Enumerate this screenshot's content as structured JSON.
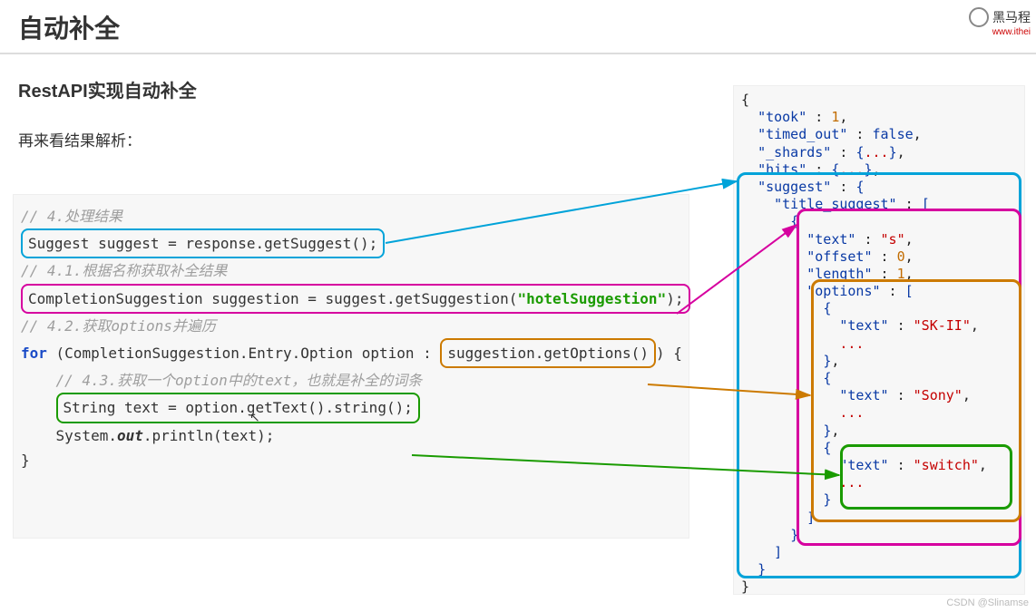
{
  "header": {
    "title": "自动补全",
    "brand_text": "黑马程",
    "brand_url": "www.ithei"
  },
  "section": {
    "subtitle": "RestAPI实现自动补全",
    "description": "再来看结果解析："
  },
  "code": {
    "c4": "// 4.处理结果",
    "l4": "Suggest suggest = response.getSuggest();",
    "c41": "// 4.1.根据名称获取补全结果",
    "l41_pre": "CompletionSuggestion suggestion = suggest.getSuggestion(",
    "l41_str": "\"hotelSuggestion\"",
    "l41_post": ");",
    "c42": "// 4.2.获取options并遍历",
    "for_kw": "for",
    "for_body_pre": " (CompletionSuggestion.Entry.Option option : ",
    "for_call": "suggestion.getOptions()",
    "for_body_post": ") {",
    "c43": "// 4.3.获取一个option中的text，也就是补全的词条",
    "l43": "String text = option.getText().string();",
    "println_pre": "    System.",
    "println_out": "out",
    "println_post": ".println(text);",
    "close": "}"
  },
  "json": {
    "open": "{",
    "took_k": "\"took\"",
    "took_v": "1",
    "timed_k": "\"timed_out\"",
    "timed_v": "false",
    "shards_k": "\"_shards\"",
    "hits_k": "\"hits\"",
    "suggest_k": "\"suggest\"",
    "title_k": "\"title_suggest\"",
    "text_k": "\"text\"",
    "text_v": "\"s\"",
    "offset_k": "\"offset\"",
    "offset_v": "0",
    "length_k": "\"length\"",
    "length_v": "1",
    "options_k": "\"options\"",
    "opt1_k": "\"text\"",
    "opt1_v": "\"SK-II\"",
    "opt2_k": "\"text\"",
    "opt2_v": "\"Sony\"",
    "opt3_k": "\"text\"",
    "opt3_v": "\"switch\"",
    "dots": "...",
    "colon_sp": " : ",
    "comma": ",",
    "lbrace": "{",
    "rbrace": "}",
    "lbrack": "[",
    "rbrack": "]",
    "lbrace_coll": "{",
    "rbrace_sp": "}",
    "close": "}"
  },
  "footer": {
    "watermark": "CSDN @Slinamse"
  }
}
